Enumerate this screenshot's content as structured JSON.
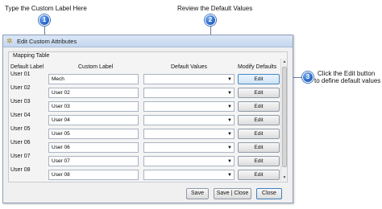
{
  "callouts": [
    {
      "number": "1",
      "text": "Type the Custom Label Here"
    },
    {
      "number": "2",
      "text": "Review the Default Values"
    },
    {
      "number": "3",
      "text": "Click the Edit button to define default values"
    }
  ],
  "callout3_lines": [
    "Click the Edit button",
    "to define default values"
  ],
  "window": {
    "title": "Edit Custom Attributes",
    "icon": "gear-icon"
  },
  "group": {
    "label": "Mapping Table"
  },
  "headers": {
    "default_label": "Default Label",
    "custom_label": "Custom Label",
    "default_values": "Default Values",
    "modify_defaults": "Modify Defaults"
  },
  "rows": [
    {
      "default_label": "User 01",
      "custom_label": "Mech",
      "default_value": "",
      "edit": "Edit"
    },
    {
      "default_label": "User 02",
      "custom_label": "User 02",
      "default_value": "",
      "edit": "Edit"
    },
    {
      "default_label": "User 03",
      "custom_label": "User 03",
      "default_value": "",
      "edit": "Edit"
    },
    {
      "default_label": "User 04",
      "custom_label": "User 04",
      "default_value": "",
      "edit": "Edit"
    },
    {
      "default_label": "User 05",
      "custom_label": "User 05",
      "default_value": "",
      "edit": "Edit"
    },
    {
      "default_label": "User 06",
      "custom_label": "User 06",
      "default_value": "",
      "edit": "Edit"
    },
    {
      "default_label": "User 07",
      "custom_label": "User 07",
      "default_value": "",
      "edit": "Edit"
    },
    {
      "default_label": "User 08",
      "custom_label": "User 08",
      "default_value": "",
      "edit": "Edit"
    }
  ],
  "buttons": {
    "save": "Save",
    "save_close": "Save | Close",
    "close": "Close"
  },
  "colors": {
    "badge": "#2f6fd0",
    "accent": "#3c7fc1"
  }
}
